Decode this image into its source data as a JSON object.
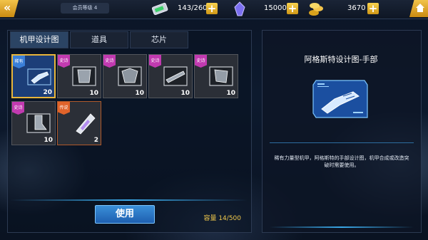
{
  "topbar": {
    "member_label": "会员等级",
    "member_level": "4",
    "energy": "143/260",
    "crystals": "15000",
    "gold": "3670"
  },
  "tabs": [
    "机甲设计图",
    "道具",
    "芯片"
  ],
  "items": [
    {
      "badge": "稀有",
      "badge_color": "#3a7fd8",
      "count": "20",
      "part": "hand",
      "selected": true
    },
    {
      "badge": "史诗",
      "badge_color": "#c13ab0",
      "count": "10",
      "part": "torso",
      "selected": false
    },
    {
      "badge": "史诗",
      "badge_color": "#c13ab0",
      "count": "10",
      "part": "chest",
      "selected": false
    },
    {
      "badge": "史诗",
      "badge_color": "#c13ab0",
      "count": "10",
      "part": "arm",
      "selected": false
    },
    {
      "badge": "史诗",
      "badge_color": "#c13ab0",
      "count": "10",
      "part": "shoulder",
      "selected": false
    },
    {
      "badge": "史诗",
      "badge_color": "#c13ab0",
      "count": "10",
      "part": "leg",
      "selected": false
    },
    {
      "badge": "传说",
      "badge_color": "#e0632a",
      "count": "2",
      "part": "capsule",
      "selected": false
    }
  ],
  "use_button": "使用",
  "capacity": "容量  14/500",
  "detail": {
    "title": "阿格斯特设计图-手部",
    "description": "稀有力量型机甲，阿格斯特的手部设计图，机甲合成或改造突破时需要使用。"
  },
  "colors": {
    "accent": "#3a8fd8",
    "gold": "#f0c84b"
  }
}
